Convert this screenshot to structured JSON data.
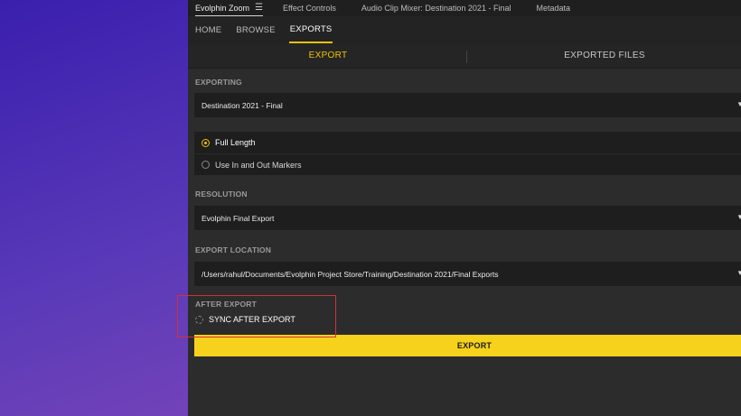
{
  "panel_tabs": [
    {
      "label": "Evolphin Zoom",
      "active": true
    },
    {
      "label": "Effect Controls"
    },
    {
      "label": "Audio Clip Mixer: Destination 2021 - Final"
    },
    {
      "label": "Metadata"
    }
  ],
  "nav": {
    "home": "HOME",
    "browse": "BROWSE",
    "exports": "EXPORTS"
  },
  "subtabs": {
    "export": "EXPORT",
    "exported_files": "EXPORTED FILES"
  },
  "exporting": {
    "label": "EXPORTING",
    "value": "Destination 2021 - Final",
    "options": [
      "Full Length",
      "Use In and Out Markers"
    ],
    "selected": "Full Length"
  },
  "resolution": {
    "label": "RESOLUTION",
    "value": "Evolphin Final Export"
  },
  "export_location": {
    "label": "EXPORT LOCATION",
    "value": "/Users/rahul/Documents/Evolphin Project Store/Training/Destination 2021/Final Exports"
  },
  "after_export": {
    "label": "AFTER EXPORT",
    "sync_label": "SYNC AFTER EXPORT",
    "sync_checked": false
  },
  "export_button": "EXPORT",
  "colors": {
    "accent": "#f2c200",
    "button": "#f7d21c",
    "highlight": "#d0303a"
  }
}
